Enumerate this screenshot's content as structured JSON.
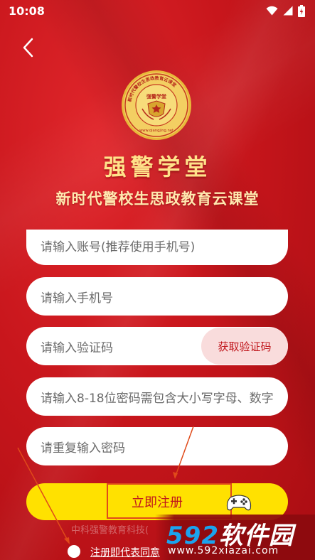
{
  "status_bar": {
    "time": "10:08",
    "icons": [
      "wifi-icon",
      "signal-icon",
      "battery-icon"
    ]
  },
  "header": {
    "back_icon": "chevron-left-icon"
  },
  "brand": {
    "emblem_ring_text": "新时代警校生思政教育云课堂",
    "emblem_center_text": "强警学堂",
    "emblem_url": "www.qiangjing.net",
    "title": "强警学堂",
    "subtitle": "新时代警校生思政教育云课堂"
  },
  "form": {
    "account_placeholder": "请输入账号(推荐使用手机号)",
    "phone_placeholder": "请输入手机号",
    "code_placeholder": "请输入验证码",
    "get_code_label": "获取验证码",
    "password_placeholder": "请输入8-18位密码需包含大小写字母、数字",
    "confirm_placeholder": "请重复输入密码",
    "register_label": "立即注册"
  },
  "footer": {
    "faded_text": "中科强警教育科技(",
    "agreement_text": "注册即代表同意"
  },
  "watermark": {
    "logo_digits": "592",
    "logo_text": "软件园",
    "url": "www.592xiazai.com"
  },
  "colors": {
    "background": "#c8161c",
    "accent_yellow": "#ffe100",
    "title_gold": "#ffe28a",
    "button_text": "#c0161c"
  }
}
